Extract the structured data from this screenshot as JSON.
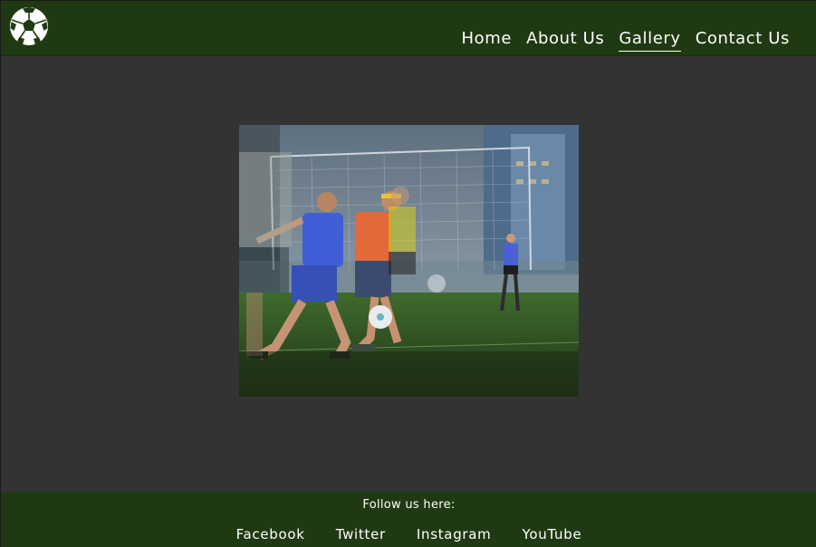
{
  "header": {
    "logo_icon": "soccer-ball-icon",
    "nav": [
      {
        "label": "Home"
      },
      {
        "label": "About Us"
      },
      {
        "label": "Gallery",
        "active": true
      },
      {
        "label": "Contact Us"
      }
    ]
  },
  "gallery": {
    "image_icon": "soccer-match-photo"
  },
  "footer": {
    "follow_text": "Follow us here:",
    "links": [
      {
        "label": "Facebook"
      },
      {
        "label": "Twitter"
      },
      {
        "label": "Instagram"
      },
      {
        "label": "YouTube"
      }
    ]
  },
  "colors": {
    "header_bg": "#1f3a12",
    "page_bg": "#333333",
    "text": "#ffffff"
  }
}
